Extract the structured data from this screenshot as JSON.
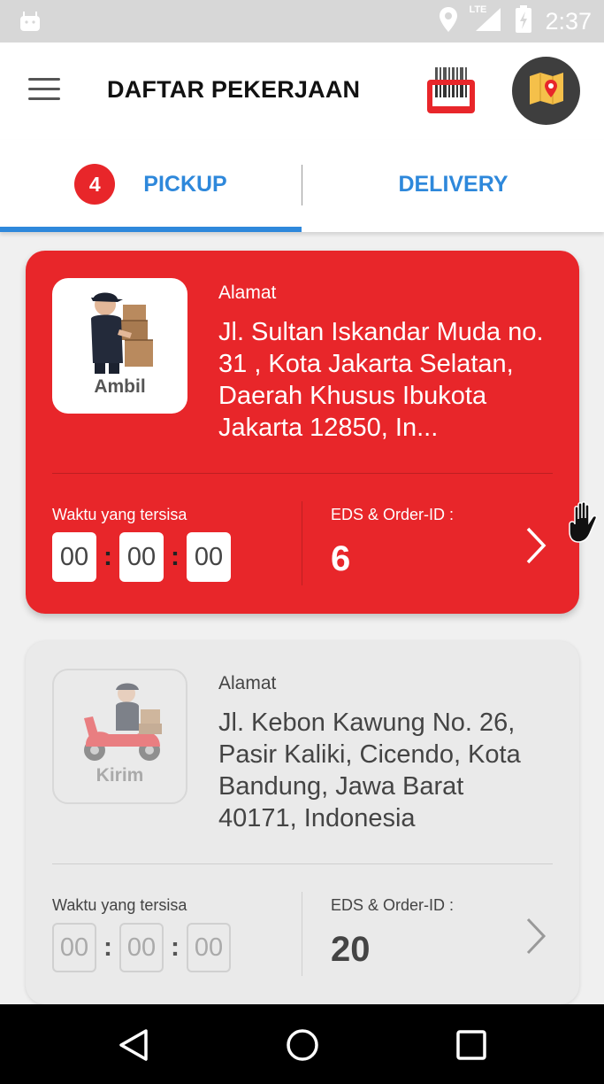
{
  "status_bar": {
    "time": "2:37",
    "network": "LTE",
    "icons": [
      "android-icon",
      "location-icon",
      "lte-signal-icon",
      "battery-charging-icon"
    ]
  },
  "app_bar": {
    "title": "DAFTAR PEKERJAAN",
    "menu_icon": "hamburger-menu-icon",
    "barcode_icon": "barcode-scanner-icon",
    "map_icon": "map-pin-icon"
  },
  "tabs": [
    {
      "label": "PICKUP",
      "badge": "4",
      "active": true
    },
    {
      "label": "DELIVERY",
      "active": false
    }
  ],
  "jobs": [
    {
      "thumb_label": "Ambil",
      "address_label": "Alamat",
      "address": "Jl. Sultan Iskandar Muda no. 31 , Kota Jakarta Selatan, Daerah Khusus Ibukota Jakarta 12850, In...",
      "time_label": "Waktu yang tersisa",
      "timer": {
        "hours": "00",
        "minutes": "00",
        "seconds": "00"
      },
      "order_label": "EDS & Order-ID :",
      "order_id": "6",
      "active": true
    },
    {
      "thumb_label": "Kirim",
      "address_label": "Alamat",
      "address": "Jl. Kebon Kawung No. 26, Pasir Kaliki, Cicendo, Kota Bandung, Jawa Barat 40171, Indonesia",
      "time_label": "Waktu yang tersisa",
      "timer": {
        "hours": "00",
        "minutes": "00",
        "seconds": "00"
      },
      "order_label": "EDS & Order-ID :",
      "order_id": "20",
      "active": false
    }
  ],
  "colors": {
    "accent_red": "#e8262a",
    "tab_blue": "#2e88db",
    "map_button": "#3e3e3e"
  },
  "nav_bar": {
    "icons": [
      "back-icon",
      "home-icon",
      "recents-icon"
    ]
  }
}
